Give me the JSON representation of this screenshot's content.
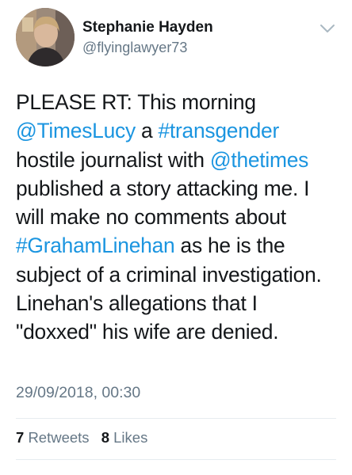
{
  "author": {
    "display_name": "Stephanie Hayden",
    "handle": "@flyinglawyer73"
  },
  "tweet": {
    "segments": [
      {
        "text": "PLEASE RT: This morning ",
        "kind": "text"
      },
      {
        "text": "@TimesLucy",
        "kind": "mention"
      },
      {
        "text": " a ",
        "kind": "text"
      },
      {
        "text": "#transgender",
        "kind": "hashtag"
      },
      {
        "text": " hostile journalist with ",
        "kind": "text"
      },
      {
        "text": "@thetimes",
        "kind": "mention"
      },
      {
        "text": " published a story attacking me. I will make no comments about ",
        "kind": "text"
      },
      {
        "text": "#GrahamLinehan",
        "kind": "hashtag"
      },
      {
        "text": " as he is the subject of a criminal investigation. Linehan's allegations that I \"doxxed\" his wife are denied.",
        "kind": "text"
      }
    ],
    "timestamp": "29/09/2018, 00:30"
  },
  "stats": {
    "retweets_count": "7",
    "retweets_label": "Retweets",
    "likes_count": "8",
    "likes_label": "Likes"
  },
  "colors": {
    "link": "#1b95e0",
    "muted": "#657786",
    "text": "#14171a",
    "divider": "#e6ecf0"
  },
  "icons": {
    "menu": "chevron-down-icon"
  }
}
